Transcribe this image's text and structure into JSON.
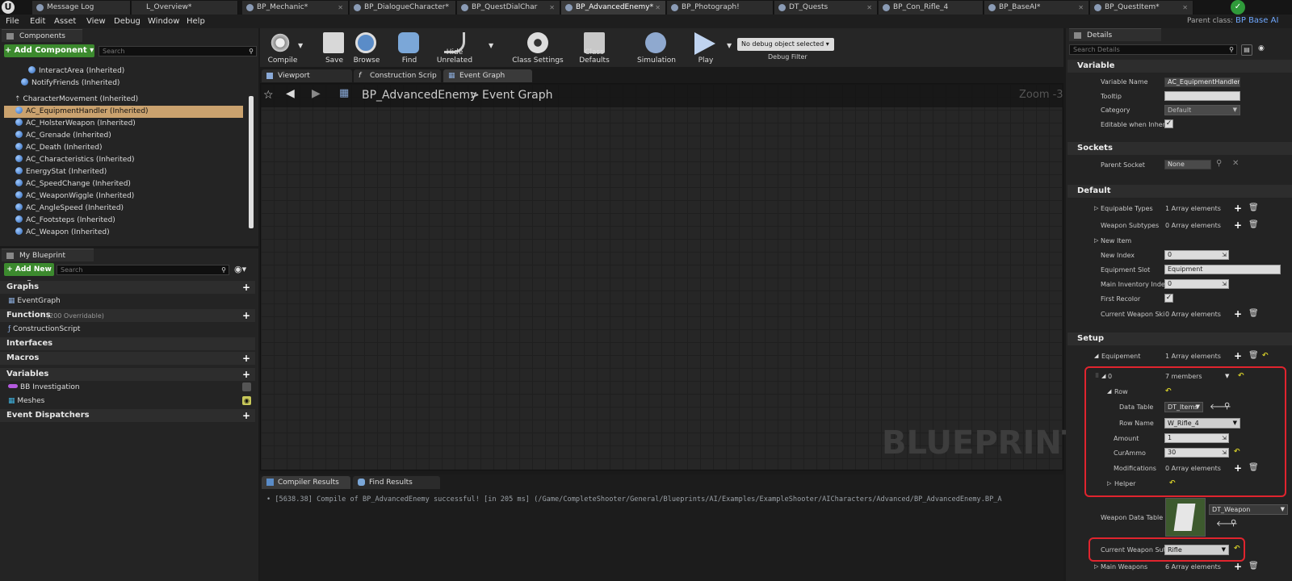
{
  "tabs": [
    {
      "label": "Message Log"
    },
    {
      "label": "L_Overview*"
    },
    {
      "label": "BP_Mechanic*"
    },
    {
      "label": "BP_DialogueCharacter*"
    },
    {
      "label": "BP_QuestDialChar"
    },
    {
      "label": "BP_AdvancedEnemy*"
    },
    {
      "label": "BP_Photograph!"
    },
    {
      "label": "DT_Quests"
    },
    {
      "label": "BP_Con_Rifle_4"
    },
    {
      "label": "BP_BaseAI*"
    },
    {
      "label": "BP_QuestItem*"
    }
  ],
  "parent_class": {
    "label": "Parent class:",
    "value": "BP Base AI"
  },
  "menu": [
    "File",
    "Edit",
    "Asset",
    "View",
    "Debug",
    "Window",
    "Help"
  ],
  "components": {
    "title": "Components",
    "add_button": "+ Add Component ▾",
    "search_placeholder": "Search",
    "items": [
      "InteractArea (Inherited)",
      "NotifyFriends (Inherited)",
      "CharacterMovement (Inherited)",
      "AC_EquipmentHandler (Inherited)",
      "AC_HolsterWeapon (Inherited)",
      "AC_Grenade (Inherited)",
      "AC_Death (Inherited)",
      "AC_Characteristics (Inherited)",
      "EnergyStat (Inherited)",
      "AC_SpeedChange (Inherited)",
      "AC_WeaponWiggle (Inherited)",
      "AC_AngleSpeed (Inherited)",
      "AC_Footsteps (Inherited)",
      "AC_Weapon (Inherited)"
    ]
  },
  "my_blueprint": {
    "title": "My Blueprint",
    "add_button": "+ Add New ▾",
    "search_placeholder": "Search",
    "graphs": "Graphs",
    "event_graph": "EventGraph",
    "functions": "Functions",
    "functions_note": "(200 Overridable)",
    "construction_script": "ConstructionScript",
    "interfaces": "Interfaces",
    "macros": "Macros",
    "variables": "Variables",
    "var_bb": "BB Investigation",
    "var_meshes": "Meshes",
    "event_dispatchers": "Event Dispatchers"
  },
  "toolbar": {
    "compile": "Compile",
    "save": "Save",
    "browse": "Browse",
    "find": "Find",
    "hide_unrelated": "Hide Unrelated",
    "class_settings": "Class Settings",
    "class_defaults": "Class Defaults",
    "simulation": "Simulation",
    "play": "Play",
    "debug_selector": "No debug object selected ▾",
    "debug_filter": "Debug Filter"
  },
  "editor_tabs": [
    "Viewport",
    "Construction Scrip",
    "Event Graph"
  ],
  "graph": {
    "breadcrumb_root": "BP_AdvancedEnemy",
    "breadcrumb_sep": ">",
    "breadcrumb_leaf": "Event Graph",
    "zoom": "Zoom -3",
    "watermark": "BLUEPRINT"
  },
  "bottom_tabs": [
    "Compiler Results",
    "Find Results"
  ],
  "compiler_log": "• [5638.38] Compile of BP_AdvancedEnemy successful! [in 205 ms] (/Game/CompleteShooter/General/Blueprints/AI/Examples/ExampleShooter/AICharacters/Advanced/BP_AdvancedEnemy.BP_A",
  "details": {
    "title": "Details",
    "search_placeholder": "Search Details",
    "variable_section": "Variable",
    "variable_name_label": "Variable Name",
    "variable_name_value": "AC_EquipmentHandler",
    "tooltip_label": "Tooltip",
    "tooltip_value": "",
    "category_label": "Category",
    "category_value": "Default",
    "editable_label": "Editable when Inheri",
    "sockets_section": "Sockets",
    "parent_socket_label": "Parent Socket",
    "parent_socket_value": "None",
    "default_section": "Default",
    "equipable_types_label": "Equipable Types",
    "equipable_types_value": "1 Array elements",
    "weapon_subtypes_label": "Weapon Subtypes",
    "weapon_subtypes_value": "0 Array elements",
    "new_item_label": "New Item",
    "new_index_label": "New Index",
    "new_index_value": "0",
    "equipment_slot_label": "Equipment Slot",
    "equipment_slot_value": "Equipment",
    "main_inventory_label": "Main Inventory Inde",
    "main_inventory_value": "0",
    "first_recolor_label": "First Recolor",
    "current_weapon_skin_label": "Current Weapon Ski",
    "current_weapon_skin_value": "0 Array elements",
    "setup_section": "Setup",
    "equipement_label": "Equipement",
    "equipement_value": "1 Array elements",
    "elem0_label": "0",
    "elem0_value": "7 members",
    "row_label": "Row",
    "data_table_label": "Data Table",
    "data_table_value": "DT_Items",
    "row_name_label": "Row Name",
    "row_name_value": "W_Rifle_4",
    "amount_label": "Amount",
    "amount_value": "1",
    "curammo_label": "CurAmmo",
    "curammo_value": "30",
    "modifications_label": "Modifications",
    "modifications_value": "0 Array elements",
    "helper_label": "Helper",
    "weapon_data_table_label": "Weapon Data Table",
    "weapon_data_table_value": "DT_Weapon",
    "current_weapon_sub_label": "Current Weapon Sut",
    "current_weapon_sub_value": "Rifle",
    "main_weapons_label": "Main Weapons",
    "main_weapons_value": "6 Array elements"
  }
}
